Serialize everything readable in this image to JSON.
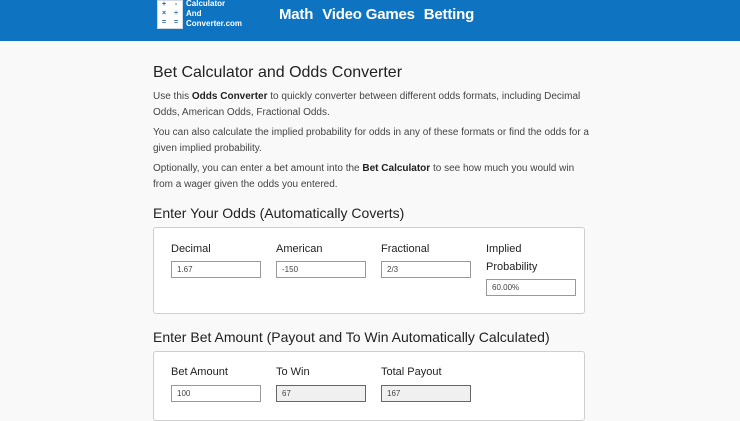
{
  "header": {
    "logo": {
      "line1": "Calculator",
      "line2": "And",
      "line3": "Converter.com",
      "symbols": [
        "+",
        "-",
        "×",
        "÷",
        "=",
        "="
      ]
    },
    "nav": [
      {
        "label": "Math"
      },
      {
        "label": "Video Games"
      },
      {
        "label": "Betting"
      }
    ],
    "background_color": "#0e74c2"
  },
  "page": {
    "title": "Bet Calculator and Odds Converter",
    "intro": {
      "p1_pre": "Use this ",
      "p1_bold": "Odds Converter",
      "p1_post": " to quickly converter between different odds formats, including Decimal Odds, American Odds, Fractional Odds.",
      "p2": "You can also calculate the implied probability for odds in any of these formats or find the odds for a given implied probability.",
      "p3_pre": "Optionally, you can enter a bet amount into the ",
      "p3_bold": "Bet Calculator",
      "p3_post": " to see how much you would win from a wager given the odds you entered."
    }
  },
  "odds_section": {
    "title": "Enter Your Odds (Automatically Coverts)",
    "decimal": {
      "label": "Decimal",
      "value": "1.67"
    },
    "american": {
      "label": "American",
      "value": "-150"
    },
    "fractional": {
      "label": "Fractional",
      "value": "2/3"
    },
    "implied": {
      "label_line1": "Implied",
      "label_line2": "Probability",
      "value": "60.00%"
    }
  },
  "bet_section": {
    "title": "Enter Bet Amount (Payout and To Win Automatically Calculated)",
    "bet_amount": {
      "label": "Bet Amount",
      "value": "100"
    },
    "to_win": {
      "label": "To Win",
      "value": "67"
    },
    "total_payout": {
      "label": "Total Payout",
      "value": "167"
    }
  }
}
